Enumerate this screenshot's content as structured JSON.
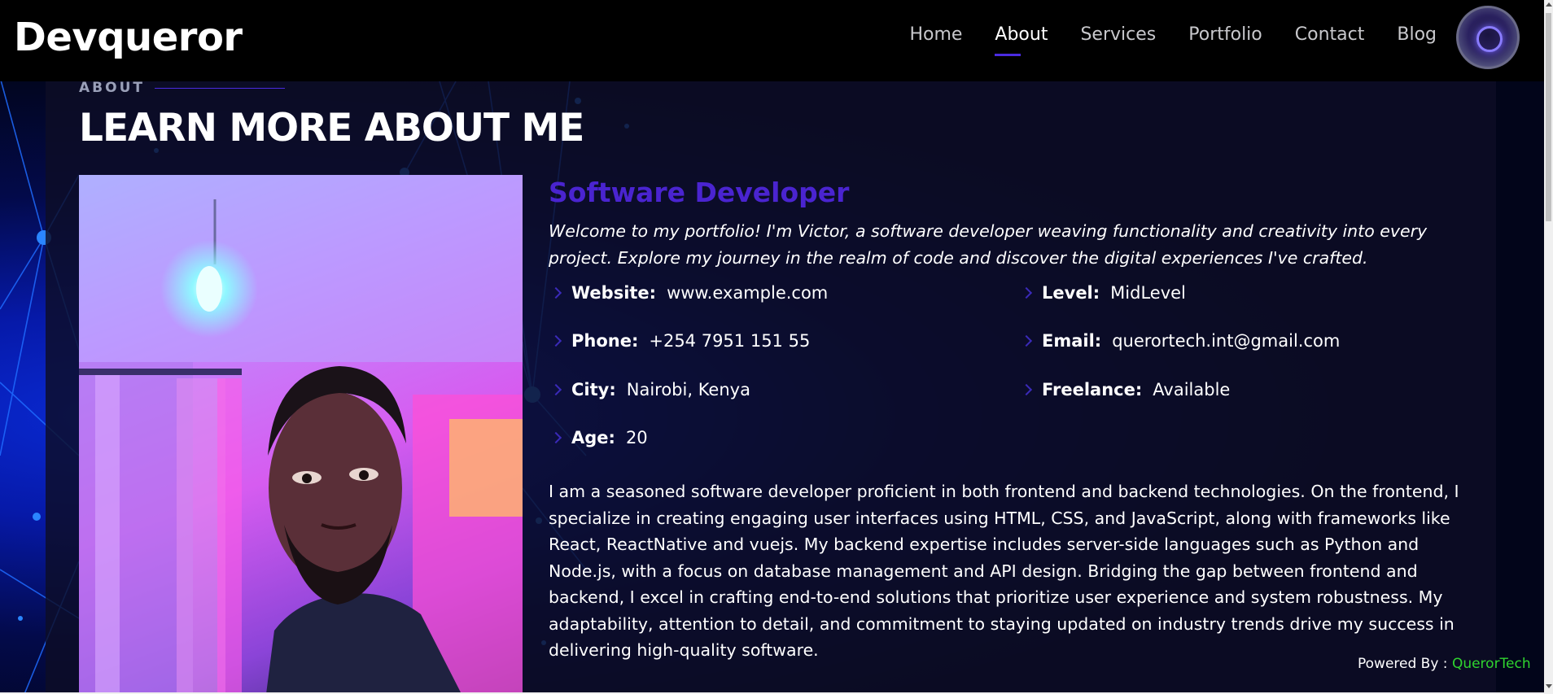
{
  "header": {
    "logo": "Devqueror",
    "nav": [
      {
        "label": "Home",
        "active": false
      },
      {
        "label": "About",
        "active": true
      },
      {
        "label": "Services",
        "active": false
      },
      {
        "label": "Portfolio",
        "active": false
      },
      {
        "label": "Contact",
        "active": false
      },
      {
        "label": "Blog",
        "active": false
      }
    ]
  },
  "about": {
    "section_label": "ABOUT",
    "title": "LEARN MORE ABOUT ME",
    "role": "Software Developer",
    "intro": "Welcome to my portfolio! I'm Victor, a software developer weaving functionality and creativity into every project. Explore my journey in the realm of code and discover the digital experiences I've crafted.",
    "info": {
      "website": {
        "key": "Website:",
        "value": "www.example.com"
      },
      "level": {
        "key": "Level:",
        "value": "MidLevel"
      },
      "phone": {
        "key": "Phone:",
        "value": "+254 7951 151 55"
      },
      "email": {
        "key": "Email:",
        "value": "querortech.int@gmail.com"
      },
      "city": {
        "key": "City:",
        "value": "Nairobi, Kenya"
      },
      "freelance": {
        "key": "Freelance:",
        "value": "Available"
      },
      "age": {
        "key": "Age:",
        "value": "20"
      }
    },
    "bio": "I am a seasoned software developer proficient in both frontend and backend technologies. On the frontend, I specialize in creating engaging user interfaces using HTML, CSS, and JavaScript, along with frameworks like React, ReactNative and vuejs. My backend expertise includes server-side languages such as Python and Node.js, with a focus on database management and API design. Bridging the gap between frontend and backend, I excel in crafting end-to-end solutions that prioritize user experience and system robustness. My adaptability, attention to detail, and commitment to staying updated on industry trends drive my success in delivering high-quality software."
  },
  "footer": {
    "powered_label": "Powered By : ",
    "powered_brand": "QuerorTech"
  },
  "colors": {
    "accent": "#4a24d0",
    "brand_green": "#2fd42f",
    "header_bg": "#000000",
    "panel_bg": "#0e0e26"
  },
  "icons": {
    "bullet": "chevron-right-icon",
    "avatar": "glowing-ring-avatar-icon"
  }
}
